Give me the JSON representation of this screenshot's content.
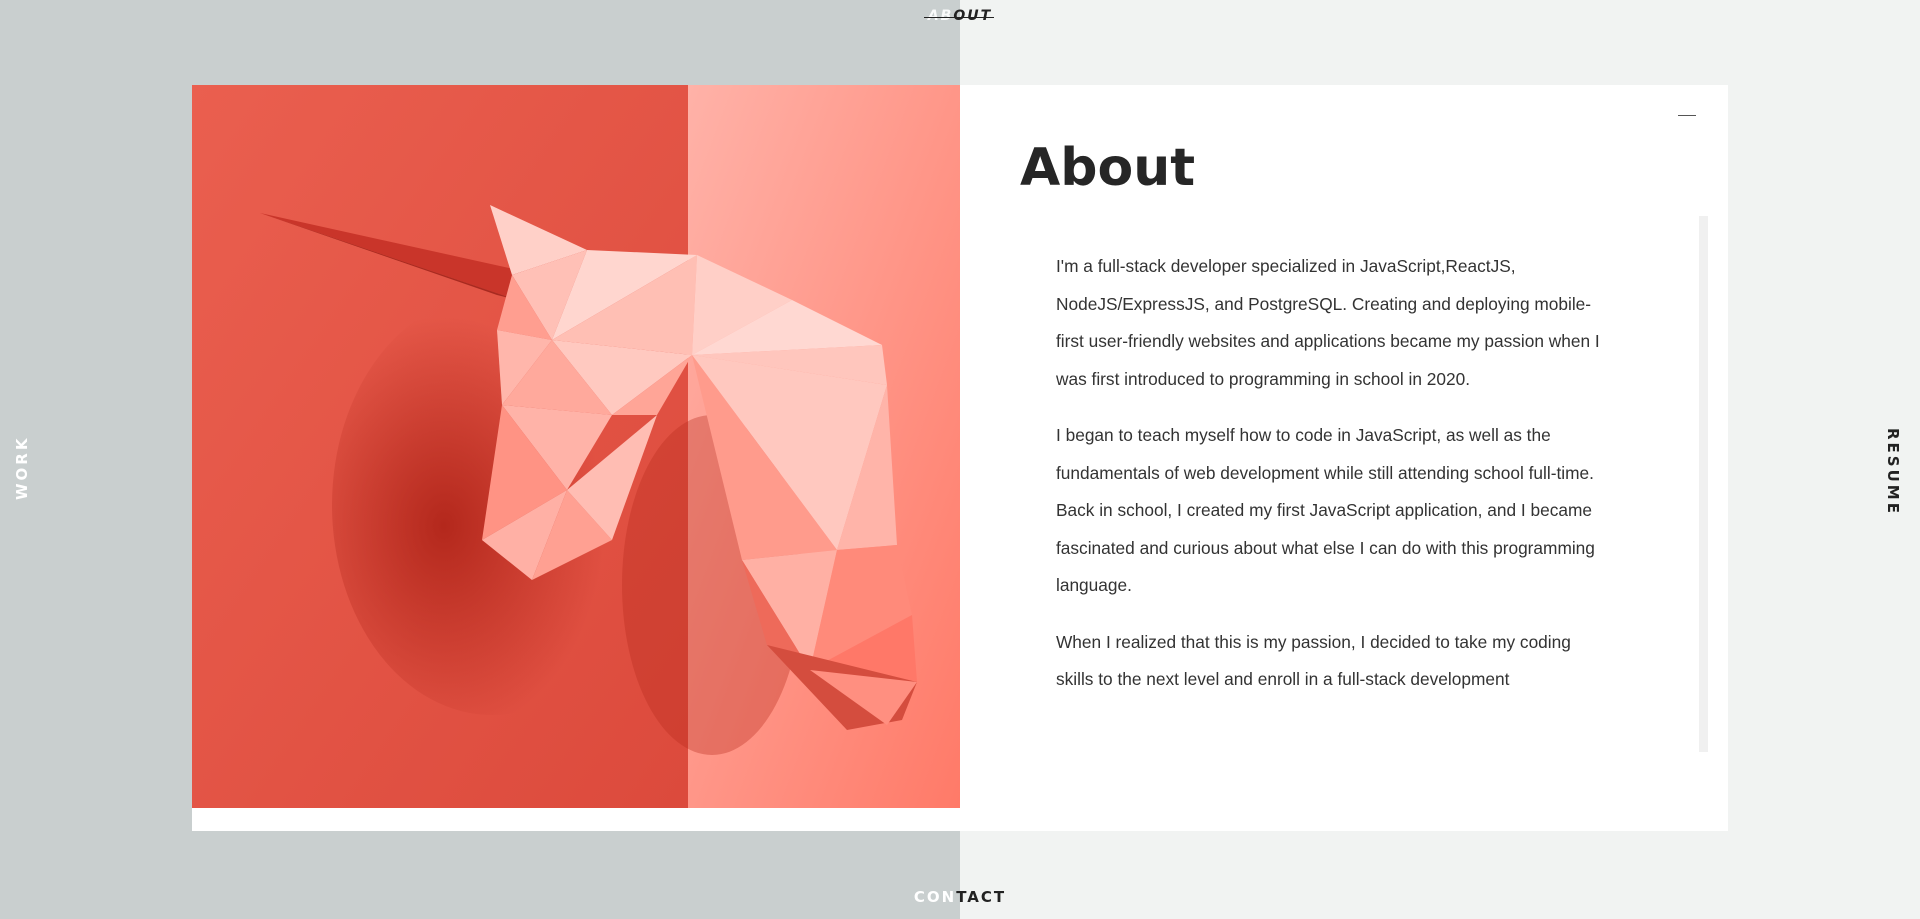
{
  "nav": {
    "top": {
      "faded": "AB",
      "dark": "OUT"
    },
    "bottom": {
      "faded": "CON",
      "dark": "TACT"
    },
    "left": "WORK",
    "right": "RESUME"
  },
  "about": {
    "title": "About",
    "close_icon": "minus-icon",
    "paragraphs": [
      "I'm a full-stack developer specialized in JavaScript,ReactJS, NodeJS/ExpressJS, and PostgreSQL. Creating and deploying mobile-first user-friendly websites and applications became my passion when I was first introduced to programming in school in 2020.",
      "I began to teach myself how to code in JavaScript, as well as the fundamentals of web development while still attending school full-time. Back in school, I created my first JavaScript application, and I became fascinated and curious about what else I can do with this programming language.",
      "When I realized that this is my passion, I decided to take my coding skills to the next level and enroll in a full-stack development"
    ]
  },
  "colors": {
    "left_background": "#c9cfcf",
    "right_background": "#f1f3f2",
    "image_coral": "#e55444",
    "image_light": "#ffb3a8",
    "unicorn": "#ffc4bb"
  }
}
